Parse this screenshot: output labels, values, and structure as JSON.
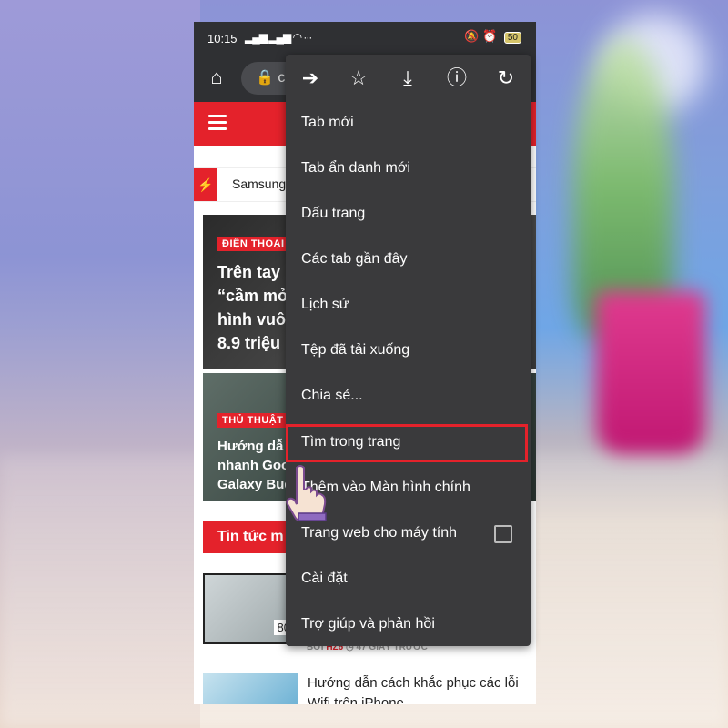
{
  "status": {
    "time": "10:15",
    "signal": "ıl ıl",
    "dots": "···",
    "battery": "50"
  },
  "url": {
    "text": "c"
  },
  "ticker": {
    "text": "Samsung"
  },
  "card1": {
    "tag": "ĐIỆN THOẠI",
    "title": "Trên tay b\n“cầm mở\nhình vuô\n8.9 triệu"
  },
  "card2": {
    "tag": "THỦ THUẬT",
    "title": "Hướng dẫ\nnhanh Goo\nGalaxy Bud"
  },
  "section": {
    "news_button": "Tin tức m"
  },
  "list": {
    "thumb_label": "80",
    "meta_by": "BỞI",
    "meta_author": "HZ6",
    "meta_time": "47 GIÂY TRƯỚC",
    "article2_title": "Hướng dẫn cách khắc phục các lỗi Wifi trên iPhone"
  },
  "menu": {
    "icons": [
      "arrow-forward-icon",
      "star-icon",
      "download-icon",
      "info-icon",
      "refresh-icon"
    ],
    "items": [
      {
        "label": "Tab mới"
      },
      {
        "label": "Tab ẩn danh mới"
      },
      {
        "label": "Dấu trang"
      },
      {
        "label": "Các tab gần đây"
      },
      {
        "label": "Lịch sử"
      },
      {
        "label": "Tệp đã tải xuống"
      },
      {
        "label": "Chia sẻ..."
      },
      {
        "label": "Tìm trong trang"
      },
      {
        "label": "Thêm vào Màn hình chính"
      },
      {
        "label": "Trang web cho máy tính"
      },
      {
        "label": "Cài đặt"
      },
      {
        "label": "Trợ giúp và phản hồi"
      }
    ]
  },
  "colors": {
    "accent": "#e4222b",
    "menu_bg": "#3a3a3c",
    "toolbar_bg": "#2f3033"
  }
}
